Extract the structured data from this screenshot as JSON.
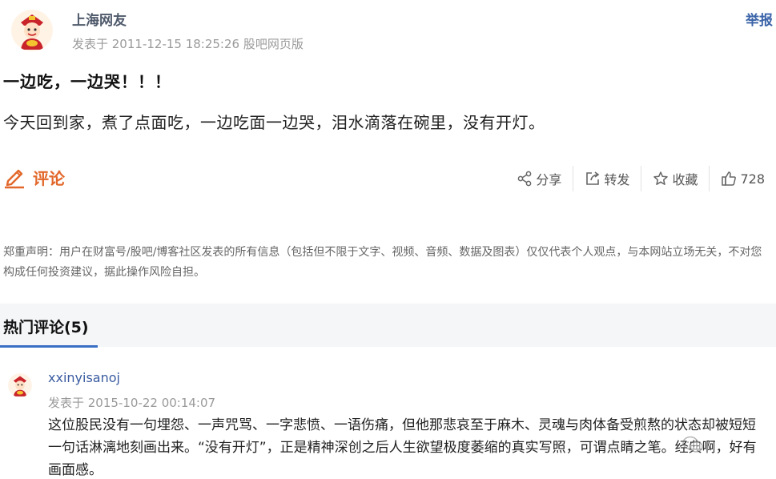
{
  "post": {
    "author": "上海网友",
    "time": "发表于 2011-12-15 18:25:26 股吧网页版",
    "report": "举报",
    "title": "一边吃，一边哭！！！",
    "body": "今天回到家，煮了点面吃，一边吃面一边哭，泪水滴落在碗里，没有开灯。"
  },
  "actions": {
    "comment": "评论",
    "share": "分享",
    "forward": "转发",
    "favorite": "收藏",
    "likes": "728"
  },
  "disclaimer": "郑重声明：用户在财富号/股吧/博客社区发表的所有信息（包括但不限于文字、视频、音频、数据及图表）仅仅代表个人观点，与本网站立场无关，不对您构成任何投资建议，据此操作风险自担。",
  "hot_comments": {
    "title": "热门评论(5)",
    "items": [
      {
        "author": "xxinyisanoj",
        "time": "发表于 2015-10-22 00:14:07",
        "text": "这位股民没有一句埋怨、一声咒骂、一字悲愤、一语伤痛，但他那悲哀至于麻木、灵魂与肉体备受煎熬的状态却被短短一句话淋漓地刻画出来。“没有开灯”，正是精神深创之后人生欲望极度萎缩的真实写照，可谓点睛之笔。经典啊，好有画面感。"
      }
    ]
  },
  "colors": {
    "accent": "#e2672a",
    "link": "#3a63a8",
    "tab_underline": "#3a6fc4"
  }
}
